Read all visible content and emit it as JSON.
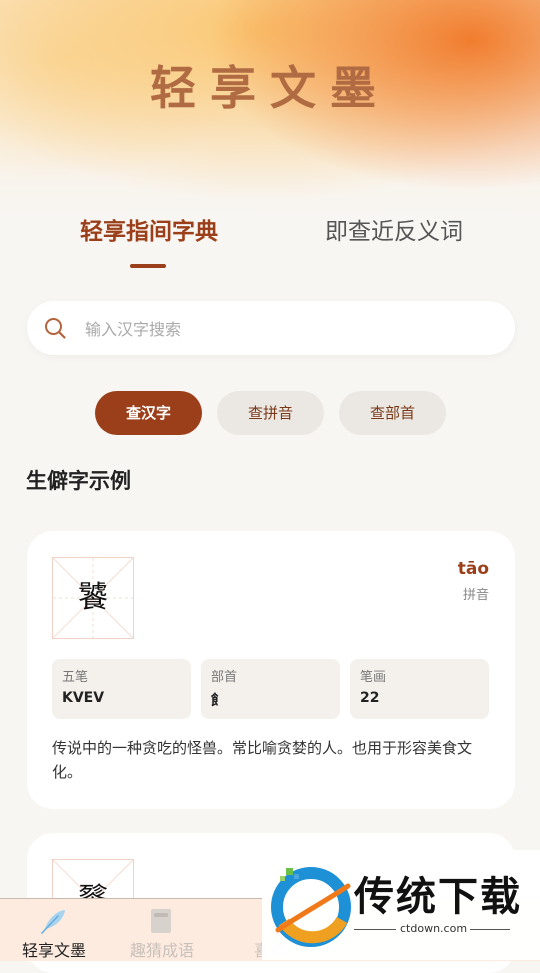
{
  "header": {
    "title": "轻享文墨"
  },
  "tabs": [
    {
      "label": "轻享指间字典",
      "active": true
    },
    {
      "label": "即查近反义词",
      "active": false
    }
  ],
  "search": {
    "placeholder": "输入汉字搜索",
    "value": ""
  },
  "chips": [
    {
      "label": "查汉字",
      "selected": true
    },
    {
      "label": "查拼音",
      "selected": false
    },
    {
      "label": "查部首",
      "selected": false
    }
  ],
  "section": {
    "title": "生僻字示例"
  },
  "cards": [
    {
      "character": "饕",
      "pinyin": "tāo",
      "pinyin_label": "拼音",
      "wubi_label": "五笔",
      "wubi": "KVEV",
      "radical_label": "部首",
      "radical": "飠",
      "strokes_label": "笔画",
      "strokes": "22",
      "description": "传说中的一种贪吃的怪兽。常比喻贪婪的人。也用于形容美食文化。"
    },
    {
      "character": "餮"
    }
  ],
  "bottom_nav": [
    {
      "label": "轻享文墨",
      "icon": "feather-icon",
      "active": true
    },
    {
      "label": "趣猜成语",
      "icon": "book-icon",
      "active": false
    },
    {
      "label": "喜读",
      "icon": "reading-icon",
      "active": false
    }
  ],
  "watermark": {
    "title": "传统下载",
    "domain": "ctdown.com"
  },
  "colors": {
    "accent": "#9a3f19",
    "title": "#b06b43",
    "chip_inactive": "#ebe7e2",
    "nav_bg": "#fdebe0"
  }
}
